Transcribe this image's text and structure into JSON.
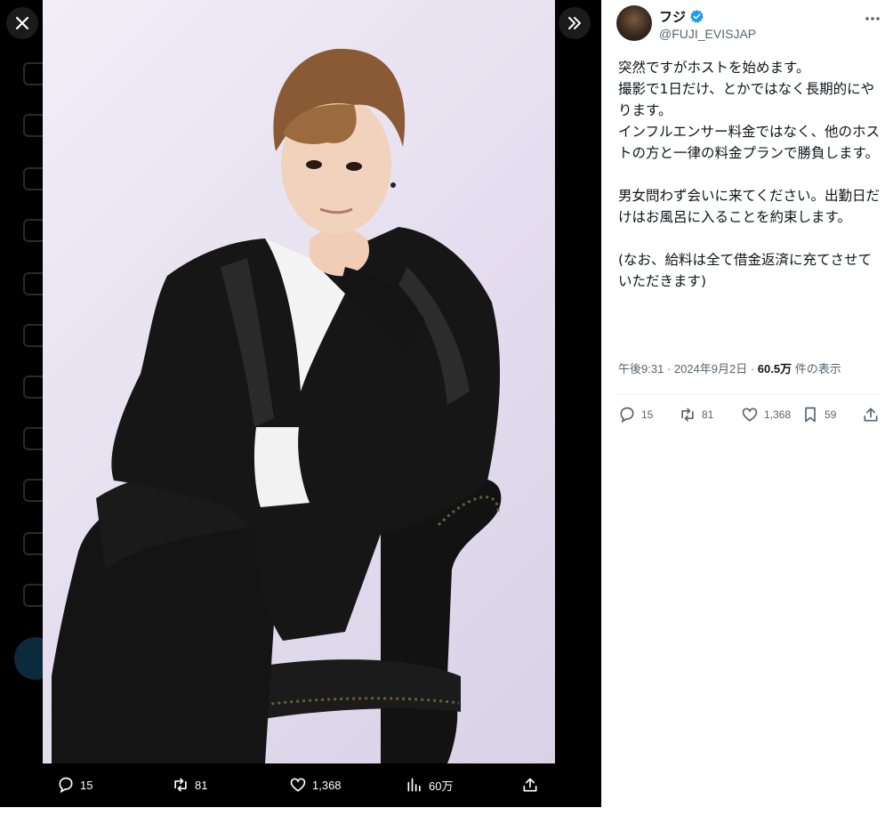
{
  "viewer": {
    "actions": {
      "replies": "15",
      "retweets": "81",
      "likes": "1,368",
      "views": "60万"
    }
  },
  "tweet": {
    "display_name": "フジ",
    "handle": "@FUJI_EVISJAP",
    "text": "突然ですがホストを始めます。\n撮影で1日だけ、とかではなく長期的にやります。\nインフルエンサー料金ではなく、他のホストの方と一律の料金プランで勝負します。\n\n男女問わず会いに来てください。出勤日だけはお風呂に入ることを約束します。\n\n(なお、給料は全て借金返済に充てさせていただきます)",
    "time": "午後9:31 · 2024年9月2日 · ",
    "views_count": "60.5万",
    "views_label": " 件の表示",
    "stats": {
      "replies": "15",
      "retweets": "81",
      "likes": "1,368",
      "bookmarks": "59"
    }
  },
  "colors": {
    "accent": "#1d9bf0",
    "secondary_text": "#536471"
  }
}
